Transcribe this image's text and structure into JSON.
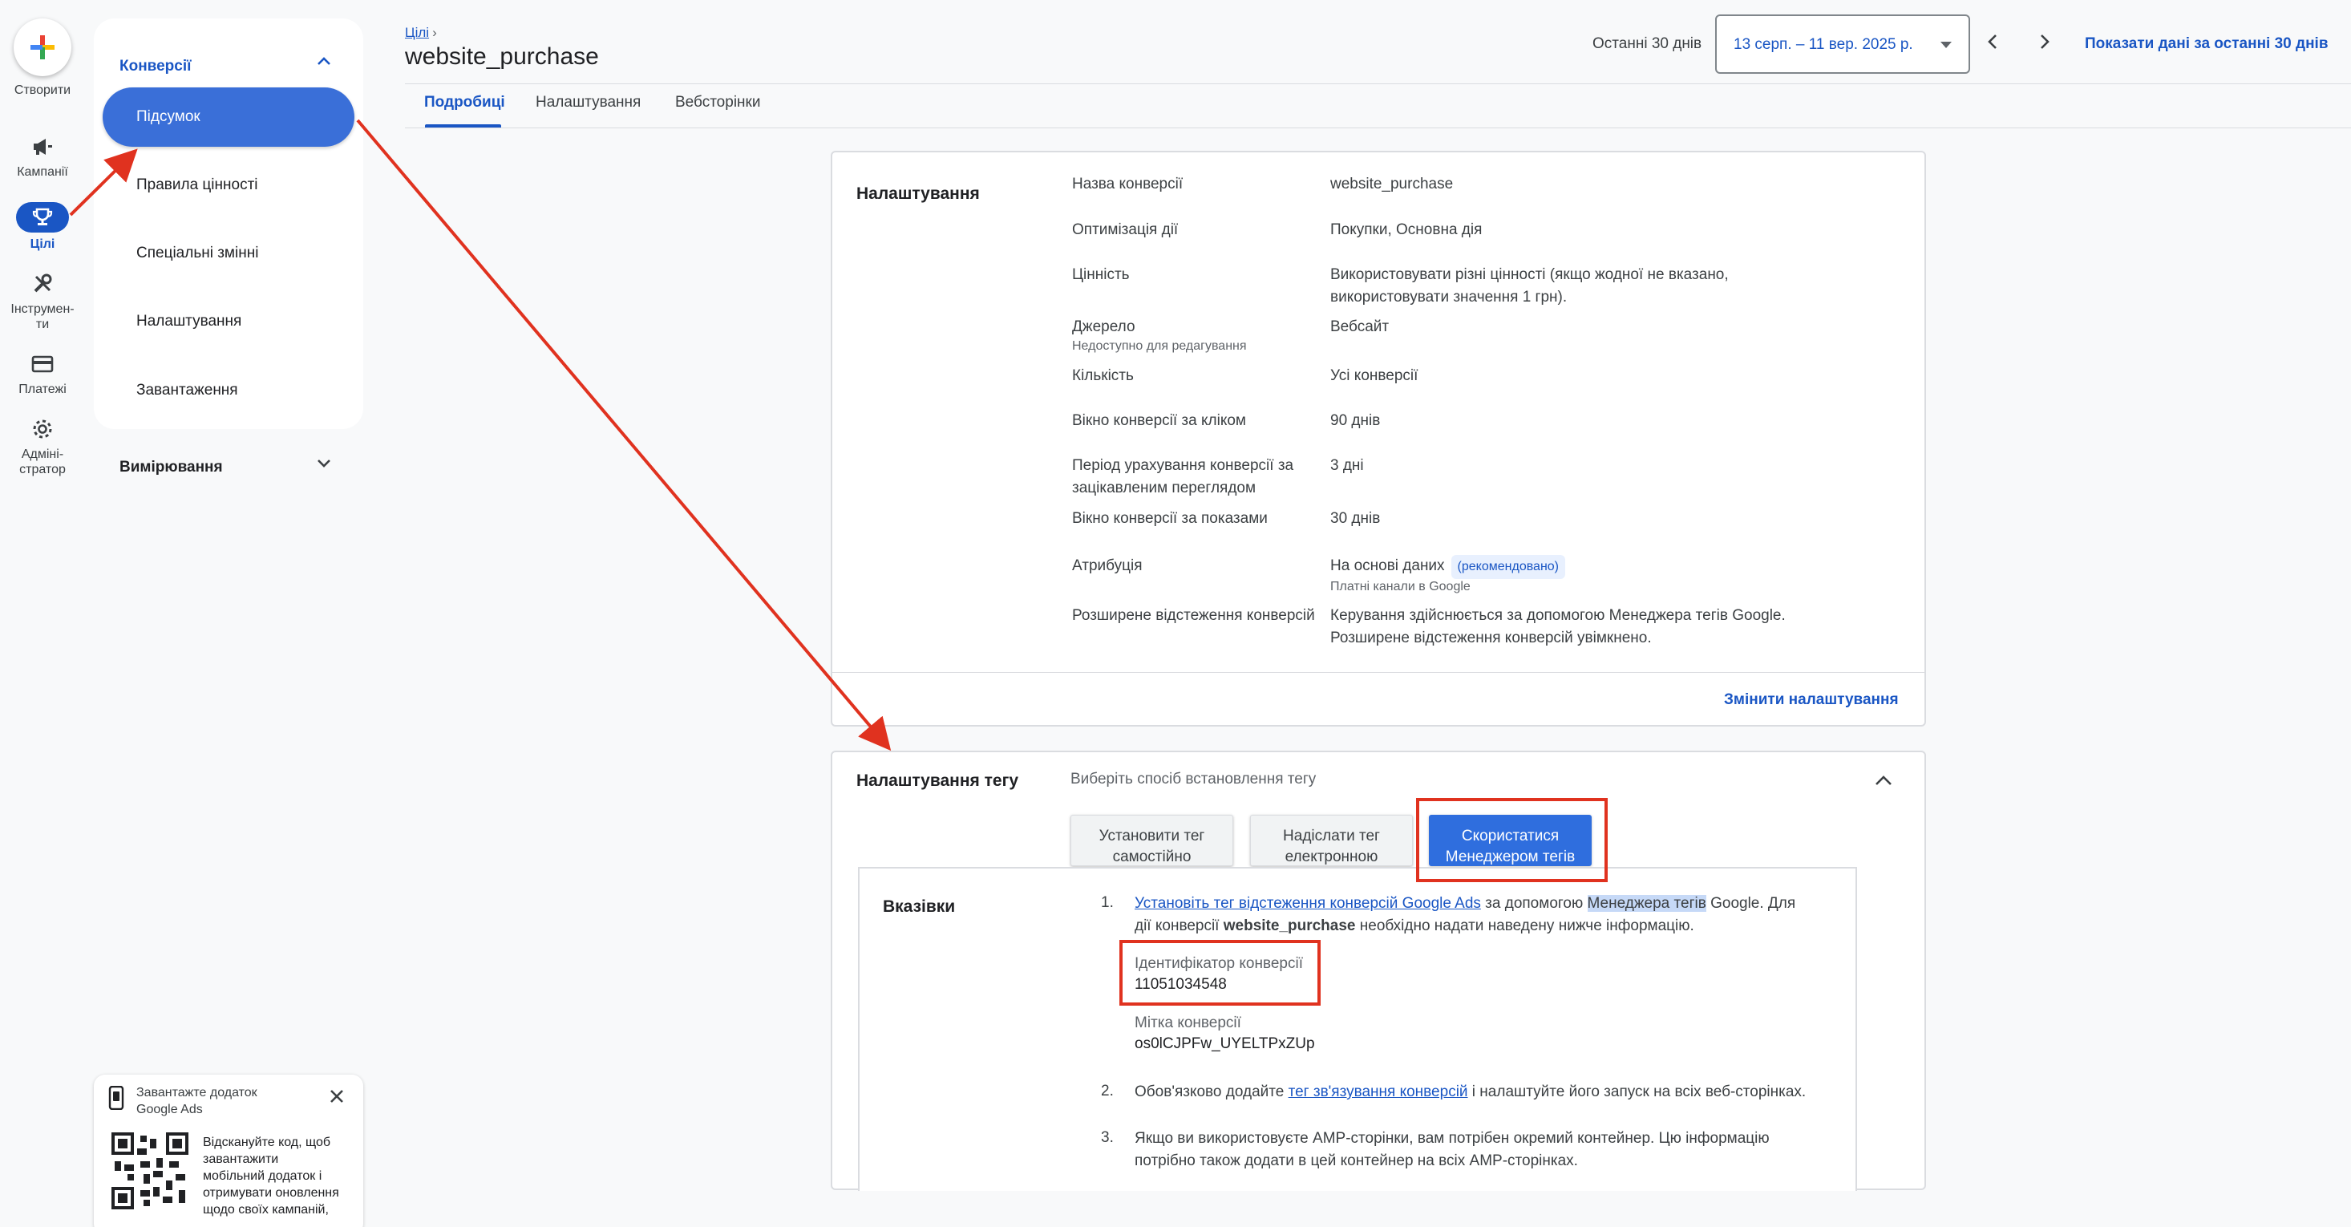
{
  "rail": {
    "create_label": "Створити",
    "items": [
      {
        "label": "Кампанії",
        "icon": "megaphone-icon"
      },
      {
        "label": "Цілі",
        "icon": "trophy-icon"
      },
      {
        "label": "Інструмен-\nти",
        "icon": "tools-icon"
      },
      {
        "label": "Платежі",
        "icon": "credit-card-icon"
      },
      {
        "label": "Адміні-\nстратор",
        "icon": "gear-icon"
      }
    ]
  },
  "subnav": {
    "section_title": "Конверсії",
    "items": [
      "Підсумок",
      "Правила цінності",
      "Спеціальні змінні",
      "Налаштування",
      "Завантаження"
    ],
    "measurement": "Вимірювання"
  },
  "header": {
    "breadcrumb": "Цілі",
    "title": "website_purchase",
    "period_label": "Останні 30 днів",
    "date_range": "13 серп. – 11 вер. 2025 р.",
    "show_last_30": "Показати дані за останні 30 днів"
  },
  "tabs": [
    "Подробиці",
    "Налаштування",
    "Вебсторінки"
  ],
  "settings": {
    "title": "Налаштування",
    "rows": [
      {
        "label": "Назва конверсії",
        "value": "website_purchase"
      },
      {
        "label": "Оптимізація дії",
        "value": "Покупки, Основна дія"
      },
      {
        "label": "Цінність",
        "value": "Використовувати різні цінності (якщо жодної не вказано,\nвикористовувати значення 1 грн)."
      },
      {
        "label": "Джерело",
        "sub": "Недоступно для редагування",
        "value": "Вебсайт"
      },
      {
        "label": "Кількість",
        "value": "Усі конверсії"
      },
      {
        "label": "Вікно конверсії за кліком",
        "value": "90 днів"
      },
      {
        "label": "Період урахування конверсії за\nзацікавленим переглядом",
        "value": "3 дні"
      },
      {
        "label": "Вікно конверсії за показами",
        "value": "30 днів"
      },
      {
        "label": "Атрибуція",
        "value": "На основі даних",
        "chip": "(рекомендовано)",
        "sub": "Платні канали в Google"
      },
      {
        "label": "Розширене відстеження конверсій",
        "value": "Керування здійснюється за допомогою Менеджера тегів Google.\nРозширене відстеження конверсій увімкнено."
      }
    ],
    "change_link": "Змінити налаштування"
  },
  "tag_setup": {
    "title": "Налаштування тегу",
    "subtitle": "Виберіть спосіб встановлення тегу",
    "options": [
      "Установити тег\nсамостійно",
      "Надіслати тег\nелектронною",
      "Скористатися\nМенеджером тегів"
    ],
    "instructions_title": "Вказівки",
    "step1": {
      "num": "1.",
      "link": "Установіть тег відстеження конверсій Google Ads",
      "text_a": " за допомогою ",
      "highlight": "Менеджера тегів",
      "text_b": " Google. Для",
      "line2_a": "дії конверсії ",
      "line2_bold": "website_purchase",
      "line2_b": " необхідно надати наведену нижче інформацію."
    },
    "conversion_id_label": "Ідентифікатор конверсії",
    "conversion_id": "11051034548",
    "conversion_label_label": "Мітка конверсії",
    "conversion_label": "os0lCJPFw_UYELTPxZUp",
    "step2": {
      "num": "2.",
      "text_a": "Обов'язково додайте ",
      "link": "тег зв'язування конверсій",
      "text_b": " і налаштуйте його запуск на всіх веб-сторінках."
    },
    "step3": {
      "num": "3.",
      "text": "Якщо ви використовуєте AMP-сторінки, вам потрібен окремий контейнер. Цю інформацію\nпотрібно також додати в цей контейнер на всіх AMP-сторінках."
    }
  },
  "promo": {
    "title": "Завантажте додаток\nGoogle Ads",
    "text": "Відскануйте код, щоб\nзавантажити\nмобільний додаток і\nотримувати оновлення\nщодо своїх кампаній,"
  },
  "colors": {
    "accent": "#1a56c4",
    "annotation": "#e0321f",
    "selected": "#2f6ede"
  }
}
